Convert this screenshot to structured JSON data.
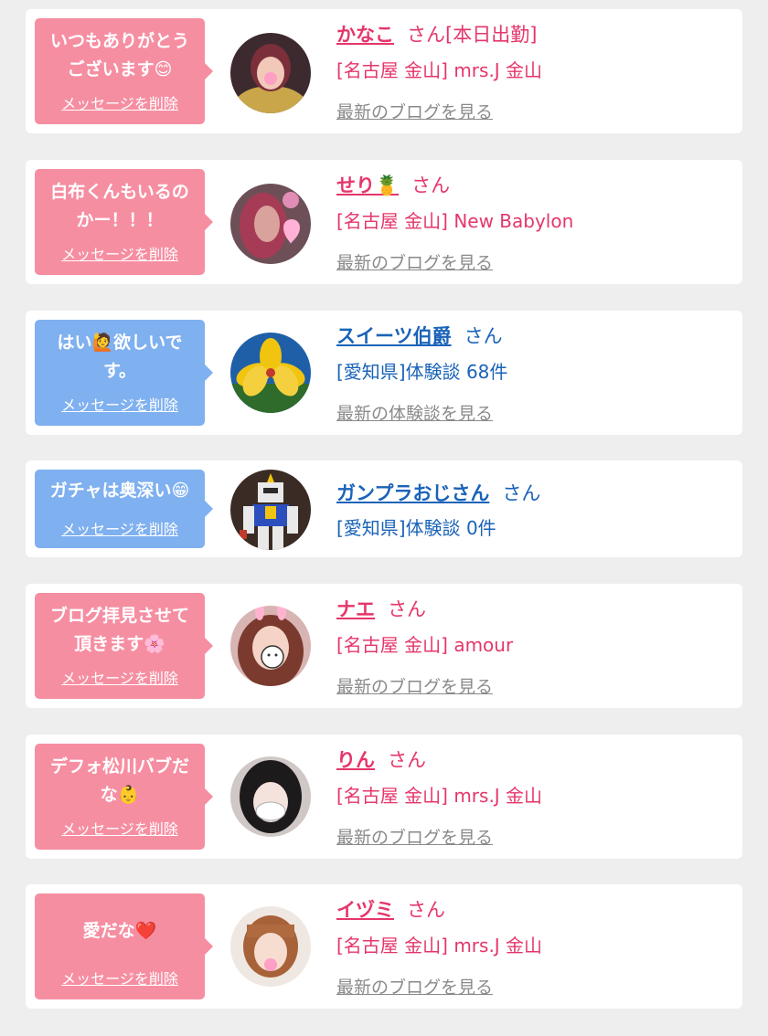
{
  "colors": {
    "pink_accent": "#e5366a",
    "blue_accent": "#1a63b8",
    "pink_bubble": "#f68ea2",
    "blue_bubble": "#7fb0ef",
    "link_gray": "#8a8a8a",
    "page_bg": "#eeeeee"
  },
  "entries": [
    {
      "message": "いつもありがとう\nございます😊",
      "delete_label": "メッセージを削除",
      "name": "かなこ",
      "honorific": "さん[本日出勤]",
      "sub": "[名古屋 金山] mrs.J 金山",
      "link": "最新のブログを見る",
      "theme": "pink"
    },
    {
      "message": "白布くんもいるの\nかー！！！",
      "delete_label": "メッセージを削除",
      "name": "せり🍍",
      "honorific": "さん",
      "sub": "[名古屋 金山] New Babylon",
      "link": "最新のブログを見る",
      "theme": "pink"
    },
    {
      "message": "はい🙋欲しいで\nす。",
      "delete_label": "メッセージを削除",
      "name": "スイーツ伯爵",
      "honorific": "さん",
      "sub": "[愛知県]体験談 68件",
      "link": "最新の体験談を見る",
      "theme": "blue"
    },
    {
      "message": "ガチャは奥深い😁",
      "delete_label": "メッセージを削除",
      "name": "ガンプラおじさん",
      "honorific": "さん",
      "sub": "[愛知県]体験談 0件",
      "link": "",
      "theme": "blue"
    },
    {
      "message": "ブログ拝見させて\n頂きます🌸",
      "delete_label": "メッセージを削除",
      "name": "ナエ",
      "honorific": "さん",
      "sub": "[名古屋 金山] amour",
      "link": "最新のブログを見る",
      "theme": "pink"
    },
    {
      "message": "デフォ松川バブだ\nな👶",
      "delete_label": "メッセージを削除",
      "name": "りん",
      "honorific": "さん",
      "sub": "[名古屋 金山] mrs.J 金山",
      "link": "最新のブログを見る",
      "theme": "pink"
    },
    {
      "message": "愛だな❤️",
      "delete_label": "メッセージを削除",
      "name": "イヅミ",
      "honorific": "さん",
      "sub": "[名古屋 金山] mrs.J 金山",
      "link": "最新のブログを見る",
      "theme": "pink"
    }
  ]
}
